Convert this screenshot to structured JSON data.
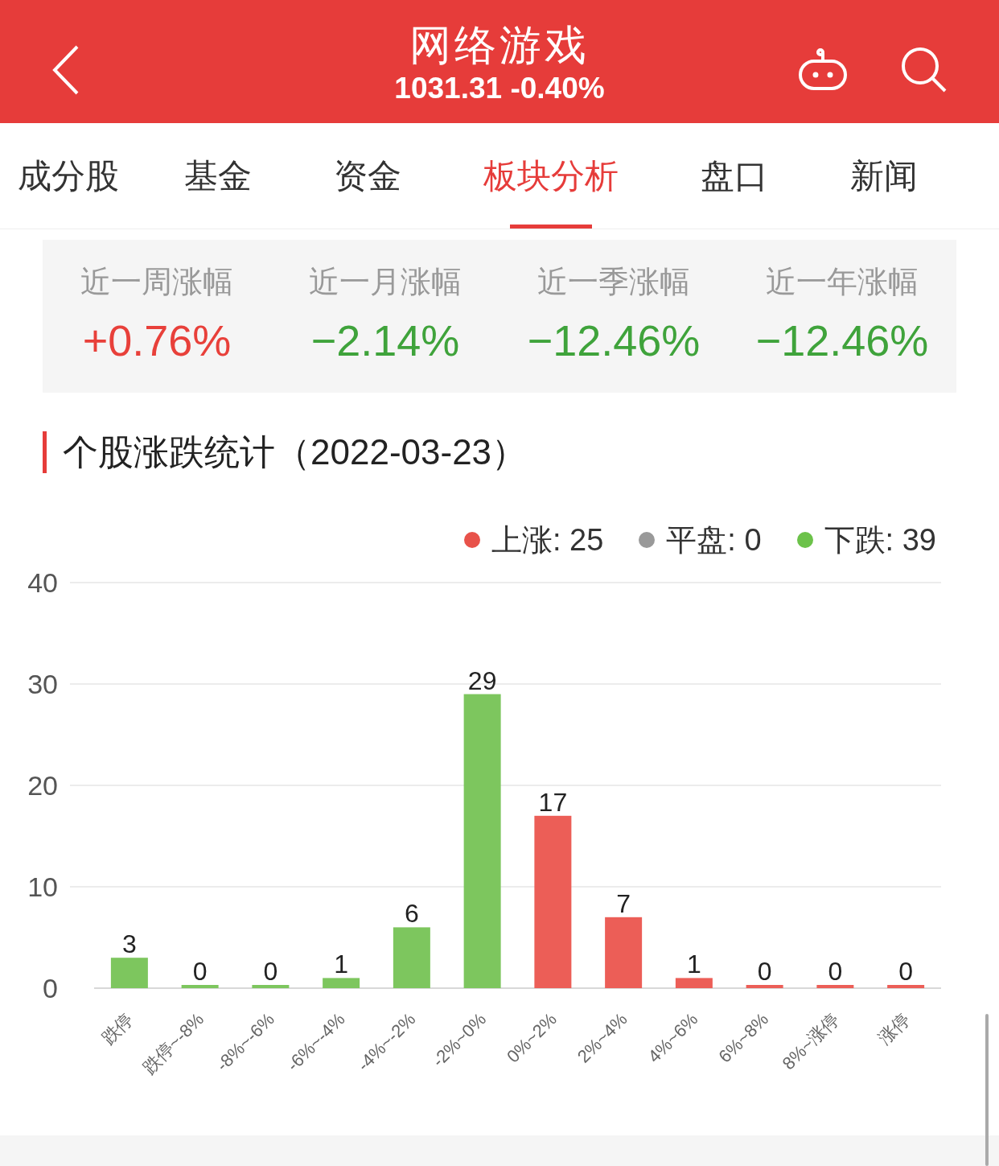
{
  "header": {
    "title": "网络游戏",
    "subtitle": "1031.31 -0.40%"
  },
  "tabs": [
    {
      "label": "成分股",
      "selected": false
    },
    {
      "label": "基金",
      "selected": false
    },
    {
      "label": "资金",
      "selected": false
    },
    {
      "label": "板块分析",
      "selected": true
    },
    {
      "label": "盘口",
      "selected": false
    },
    {
      "label": "新闻",
      "selected": false
    }
  ],
  "stats": [
    {
      "label": "近一周涨幅",
      "value": "+0.76%",
      "color": "#e8403a"
    },
    {
      "label": "近一月涨幅",
      "value": "−2.14%",
      "color": "#3fa33b"
    },
    {
      "label": "近一季涨幅",
      "value": "−12.46%",
      "color": "#3fa33b"
    },
    {
      "label": "近一年涨幅",
      "value": "−12.46%",
      "color": "#3fa33b"
    }
  ],
  "section": {
    "title": "个股涨跌统计（2022-03-23）"
  },
  "legend": [
    {
      "label": "上涨: 25",
      "color": "#e8524a"
    },
    {
      "label": "平盘: 0",
      "color": "#999999"
    },
    {
      "label": "下跌: 39",
      "color": "#6cc24a"
    }
  ],
  "chart_data": {
    "type": "bar",
    "categories": [
      "跌停",
      "跌停~-8%",
      "-8%~-6%",
      "-6%~-4%",
      "-4%~-2%",
      "-2%~0%",
      "0%~2%",
      "2%~4%",
      "4%~6%",
      "6%~8%",
      "8%~涨停",
      "涨停"
    ],
    "series": [
      {
        "color": "#7dc65e",
        "values": [
          3,
          0,
          0,
          1,
          6,
          29,
          null,
          null,
          null,
          null,
          null,
          null
        ]
      },
      {
        "color": "#ec5e57",
        "values": [
          null,
          null,
          null,
          null,
          null,
          null,
          17,
          7,
          1,
          0,
          0,
          0
        ]
      }
    ],
    "stacked": true,
    "grid": true,
    "ylim": [
      0,
      40
    ],
    "yticks": [
      0,
      10,
      20,
      30,
      40
    ],
    "data_labels": true
  }
}
